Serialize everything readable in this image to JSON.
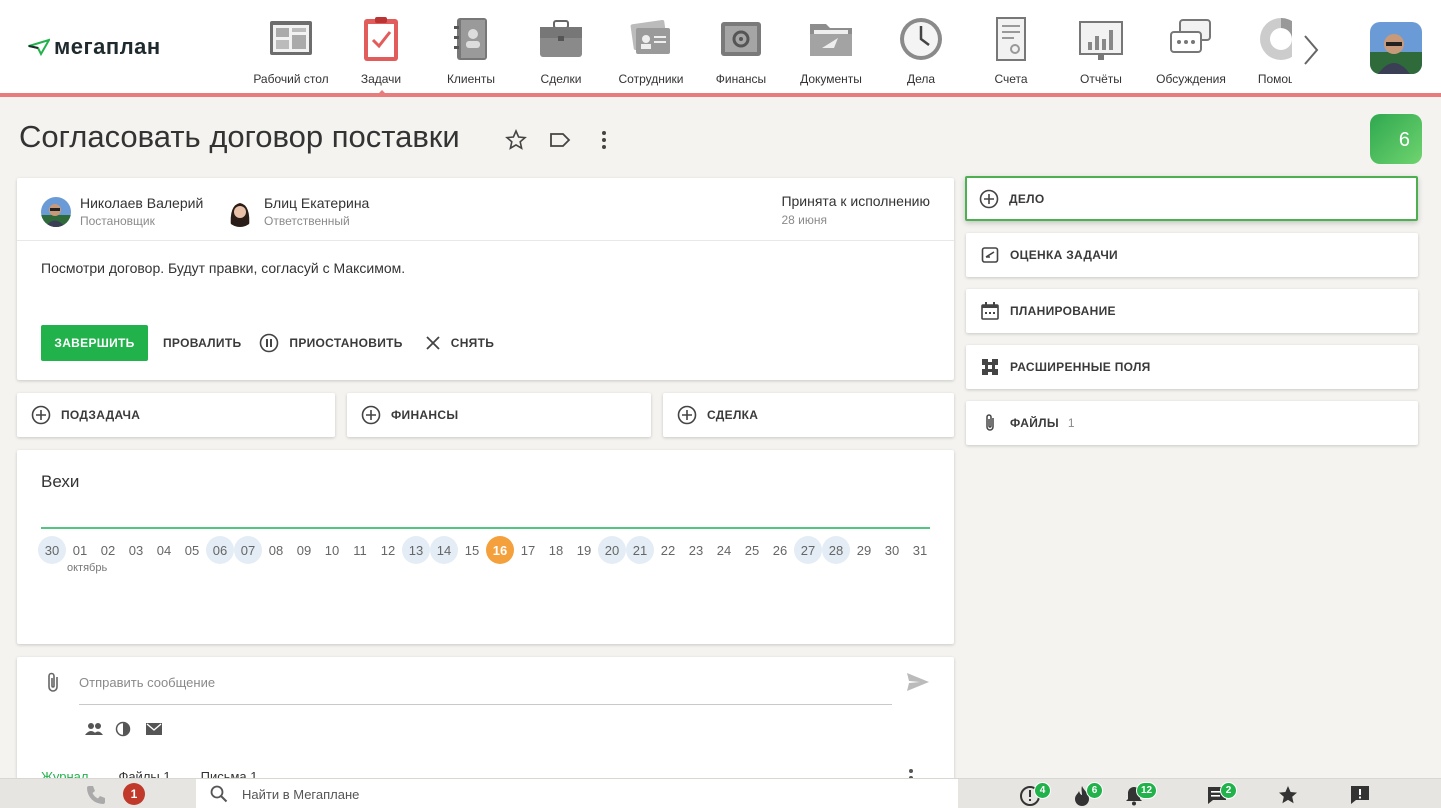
{
  "app": {
    "logo_text": "мегаплан"
  },
  "nav": {
    "items": [
      {
        "label": "Рабочий стол",
        "icon": "desktop-icon"
      },
      {
        "label": "Задачи",
        "icon": "tasks-icon",
        "active": true
      },
      {
        "label": "Клиенты",
        "icon": "clients-icon"
      },
      {
        "label": "Сделки",
        "icon": "deals-icon"
      },
      {
        "label": "Сотрудники",
        "icon": "employees-icon"
      },
      {
        "label": "Финансы",
        "icon": "finance-icon"
      },
      {
        "label": "Документы",
        "icon": "documents-icon"
      },
      {
        "label": "Дела",
        "icon": "clock-icon"
      },
      {
        "label": "Счета",
        "icon": "invoices-icon"
      },
      {
        "label": "Отчёты",
        "icon": "reports-icon"
      },
      {
        "label": "Обсуждения",
        "icon": "discussions-icon"
      },
      {
        "label": "Помощь",
        "icon": "help-icon"
      }
    ],
    "active_color": "#e87c7c"
  },
  "task": {
    "title": "Согласовать договор поставки",
    "side_badge": "6",
    "owner": {
      "name": "Николаев Валерий",
      "role": "Постановщик"
    },
    "responsible": {
      "name": "Блиц Екатерина",
      "role": "Ответственный"
    },
    "status": "Принята к исполнению",
    "status_date": "28 июня",
    "description": "Посмотри договор. Будут правки, согласуй с Максимом.",
    "actions": {
      "complete": "ЗАВЕРШИТЬ",
      "fail": "ПРОВАЛИТЬ",
      "pause": "ПРИОСТАНОВИТЬ",
      "remove": "СНЯТЬ"
    }
  },
  "add_cards": {
    "subtask": "ПОДЗАДАЧА",
    "finance": "ФИНАНСЫ",
    "deal": "СДЕЛКА"
  },
  "side_cards": {
    "todo": "ДЕЛО",
    "rating": "ОЦЕНКА ЗАДАЧИ",
    "planning": "ПЛАНИРОВАНИЕ",
    "ext_fields": "РАСШИРЕННЫЕ ПОЛЯ",
    "files": "ФАЙЛЫ",
    "files_count": "1"
  },
  "milestones": {
    "title": "Вехи",
    "month": "октябрь",
    "days": [
      {
        "d": "30",
        "hl": true
      },
      {
        "d": "01"
      },
      {
        "d": "02"
      },
      {
        "d": "03"
      },
      {
        "d": "04"
      },
      {
        "d": "05"
      },
      {
        "d": "06",
        "hl": true
      },
      {
        "d": "07",
        "hl": true
      },
      {
        "d": "08"
      },
      {
        "d": "09"
      },
      {
        "d": "10"
      },
      {
        "d": "11"
      },
      {
        "d": "12"
      },
      {
        "d": "13",
        "hl": true
      },
      {
        "d": "14",
        "hl": true
      },
      {
        "d": "15"
      },
      {
        "d": "16",
        "today": true
      },
      {
        "d": "17"
      },
      {
        "d": "18"
      },
      {
        "d": "19"
      },
      {
        "d": "20",
        "hl": true
      },
      {
        "d": "21",
        "hl": true
      },
      {
        "d": "22"
      },
      {
        "d": "23"
      },
      {
        "d": "24"
      },
      {
        "d": "25"
      },
      {
        "d": "26"
      },
      {
        "d": "27",
        "hl": true
      },
      {
        "d": "28",
        "hl": true
      },
      {
        "d": "29"
      },
      {
        "d": "30"
      },
      {
        "d": "31"
      }
    ]
  },
  "message": {
    "placeholder": "Отправить сообщение",
    "tabs": [
      {
        "label": "Журнал",
        "active": true
      },
      {
        "label": "Файлы 1"
      },
      {
        "label": "Письма 1"
      }
    ]
  },
  "bottom": {
    "phone_badge": "1",
    "search_placeholder": "Найти в Мегаплане",
    "alerts_badge": "4",
    "fire_badge": "6",
    "bell_badge": "12",
    "chat_badge": "2"
  },
  "colors": {
    "accent_green": "#22b24c",
    "today": "#f4a03c",
    "milestone_line": "#53c482"
  }
}
